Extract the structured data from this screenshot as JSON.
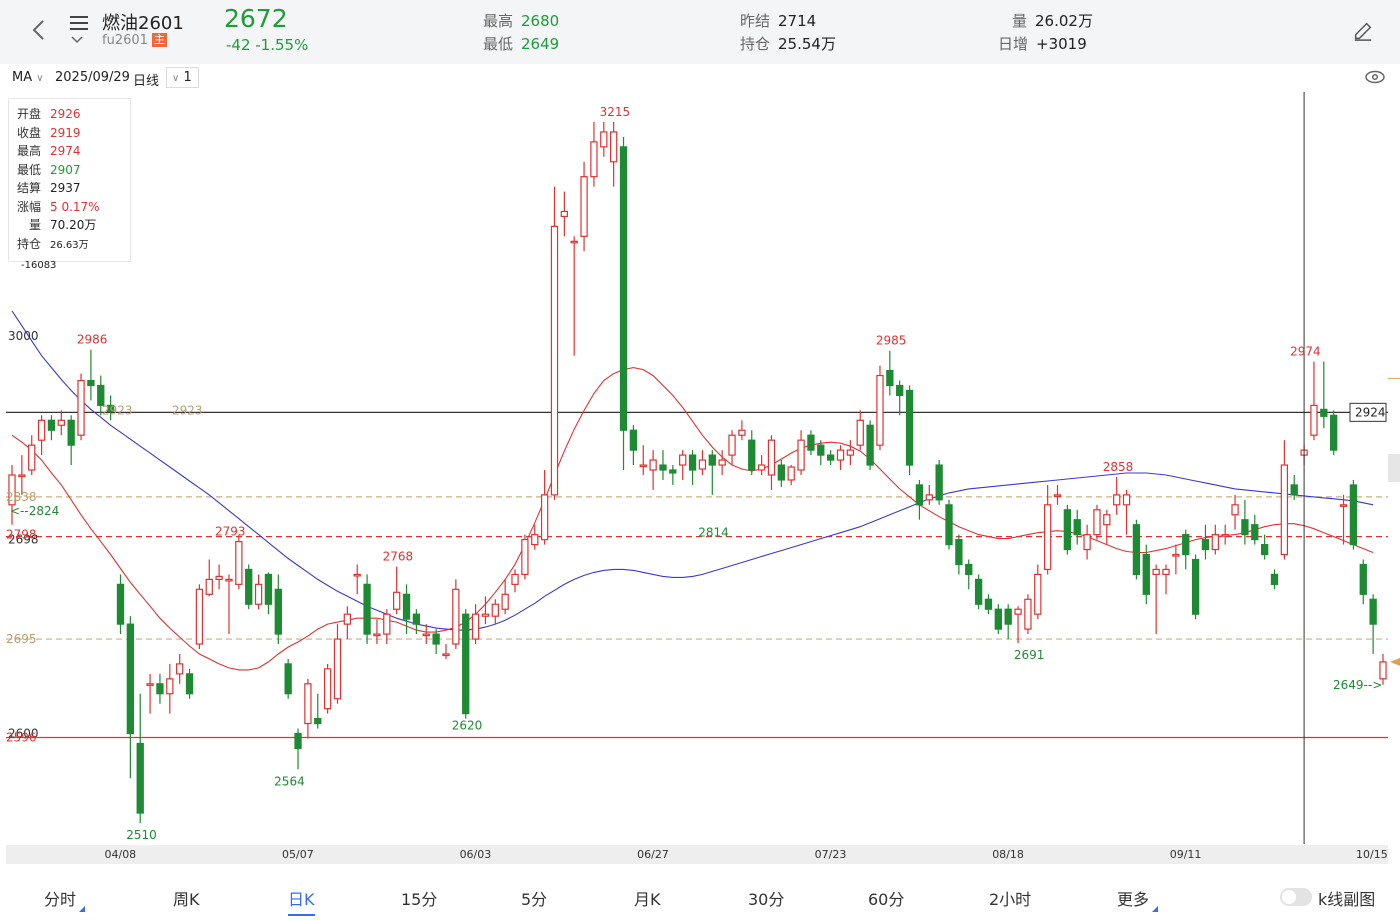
{
  "header": {
    "title": "燃油2601",
    "code": "fu2601",
    "main_badge": "主",
    "price": "2672",
    "change": "-42  -1.55%",
    "high_label": "最高",
    "high": "2680",
    "low_label": "最低",
    "low": "2649",
    "settle_label": "昨结",
    "settle": "2714",
    "oi_label": "持仓",
    "oi": "25.54万",
    "vol_label": "量",
    "vol": "26.02万",
    "daily_label": "日增",
    "daily": "+3019"
  },
  "toolbar": {
    "indicator": "MA",
    "date": "2025/09/29",
    "period": "日线",
    "count": "1"
  },
  "infobox": {
    "open_label": "开盘",
    "open": "2926",
    "close_label": "收盘",
    "close": "2919",
    "high_label": "最高",
    "high": "2974",
    "low_label": "最低",
    "low": "2907",
    "settle_label": "结算",
    "settle": "2937",
    "pct_label": "涨幅",
    "pct": "5  0.17%",
    "vol_label": "量",
    "vol": "70.20万",
    "oi_label": "持仓",
    "oi": "26.63万",
    "oi_chg": "-16083"
  },
  "chart_data": {
    "type": "candlestick",
    "y_axis_labels": [
      "3000",
      "2698",
      "2600"
    ],
    "ylim": [
      2500,
      3250
    ],
    "x_labels": [
      "04/08",
      "05/07",
      "06/03",
      "06/27",
      "07/23",
      "08/18",
      "09/11",
      "10/15"
    ],
    "x_label_index": [
      11,
      29,
      47,
      65,
      83,
      101,
      119,
      136
    ],
    "point_labels": [
      {
        "text": "2986",
        "i": 8,
        "y": 2986,
        "color": "red"
      },
      {
        "text": "2510",
        "i": 13,
        "y": 2510,
        "color": "green"
      },
      {
        "text": "2793",
        "i": 22,
        "y": 2793,
        "color": "red"
      },
      {
        "text": "2564",
        "i": 28,
        "y": 2564,
        "color": "green"
      },
      {
        "text": "2768",
        "i": 39,
        "y": 2768,
        "color": "red"
      },
      {
        "text": "2620",
        "i": 46,
        "y": 2620,
        "color": "green"
      },
      {
        "text": "3215",
        "i": 61,
        "y": 3215,
        "color": "red"
      },
      {
        "text": "2814",
        "i": 71,
        "y": 2814,
        "color": "green"
      },
      {
        "text": "2985",
        "i": 89,
        "y": 2985,
        "color": "red"
      },
      {
        "text": "2691",
        "i": 103,
        "y": 2691,
        "color": "green"
      },
      {
        "text": "2858",
        "i": 112,
        "y": 2858,
        "color": "red"
      },
      {
        "text": "2974",
        "i": 131,
        "y": 2974,
        "color": "red"
      }
    ],
    "side_labels": [
      {
        "text": "2923",
        "y": 2923,
        "color": "#b8a070"
      },
      {
        "text": "2923",
        "y": 2923,
        "color": "#b8a070"
      },
      {
        "text": "2838",
        "y": 2838,
        "color": "#b8a070"
      },
      {
        "text": "2798",
        "y": 2798,
        "color": "#e03232"
      },
      {
        "text": "2695",
        "y": 2695,
        "color": "#b8a070"
      },
      {
        "text": "2596",
        "y": 2596,
        "color": "#e03232"
      }
    ],
    "annotations": [
      "<--2824",
      "2649-->"
    ],
    "crosshair_value": "2924",
    "hlines": [
      {
        "y": 2923,
        "color": "#333333",
        "dash": false
      },
      {
        "y": 2838,
        "color": "#c8b080",
        "dash": true
      },
      {
        "y": 2798,
        "color": "#e03232",
        "dash": true
      },
      {
        "y": 2695,
        "color": "#c8b080",
        "dash": true
      },
      {
        "y": 2596,
        "color": "#e03232",
        "dash": false
      }
    ],
    "candles": [
      [
        2830,
        2860,
        2870,
        2810
      ],
      [
        2860,
        2860,
        2880,
        2840
      ],
      [
        2865,
        2890,
        2900,
        2860
      ],
      [
        2895,
        2915,
        2920,
        2880
      ],
      [
        2915,
        2905,
        2920,
        2895
      ],
      [
        2910,
        2915,
        2925,
        2900
      ],
      [
        2915,
        2890,
        2920,
        2870
      ],
      [
        2900,
        2955,
        2962,
        2895
      ],
      [
        2955,
        2950,
        2986,
        2935
      ],
      [
        2950,
        2930,
        2960,
        2920
      ],
      [
        2930,
        2924,
        2940,
        2915
      ],
      [
        2750,
        2710,
        2760,
        2700
      ],
      [
        2710,
        2600,
        2718,
        2555
      ],
      [
        2590,
        2520,
        2640,
        2510
      ],
      [
        2650,
        2650,
        2660,
        2620
      ],
      [
        2650,
        2640,
        2660,
        2630
      ],
      [
        2640,
        2655,
        2670,
        2620
      ],
      [
        2660,
        2670,
        2680,
        2650
      ],
      [
        2660,
        2640,
        2665,
        2635
      ],
      [
        2690,
        2745,
        2750,
        2685
      ],
      [
        2740,
        2755,
        2775,
        2738
      ],
      [
        2755,
        2758,
        2770,
        2745
      ],
      [
        2755,
        2755,
        2760,
        2700
      ],
      [
        2750,
        2793,
        2800,
        2745
      ],
      [
        2765,
        2730,
        2770,
        2725
      ],
      [
        2730,
        2750,
        2760,
        2725
      ],
      [
        2760,
        2730,
        2762,
        2720
      ],
      [
        2745,
        2700,
        2760,
        2690
      ],
      [
        2670,
        2640,
        2675,
        2635
      ],
      [
        2600,
        2585,
        2605,
        2564
      ],
      [
        2610,
        2650,
        2655,
        2595
      ],
      [
        2615,
        2610,
        2640,
        2605
      ],
      [
        2625,
        2665,
        2670,
        2620
      ],
      [
        2635,
        2695,
        2710,
        2630
      ],
      [
        2710,
        2720,
        2728,
        2695
      ],
      [
        2760,
        2760,
        2770,
        2740
      ],
      [
        2750,
        2700,
        2760,
        2690
      ],
      [
        2700,
        2700,
        2715,
        2690
      ],
      [
        2700,
        2720,
        2725,
        2690
      ],
      [
        2725,
        2742,
        2768,
        2720
      ],
      [
        2740,
        2715,
        2750,
        2700
      ],
      [
        2720,
        2710,
        2725,
        2700
      ],
      [
        2700,
        2700,
        2710,
        2690
      ],
      [
        2700,
        2690,
        2705,
        2680
      ],
      [
        2680,
        2680,
        2690,
        2675
      ],
      [
        2690,
        2745,
        2755,
        2685
      ],
      [
        2720,
        2620,
        2725,
        2615
      ],
      [
        2695,
        2720,
        2730,
        2690
      ],
      [
        2718,
        2720,
        2738,
        2710
      ],
      [
        2718,
        2730,
        2735,
        2710
      ],
      [
        2725,
        2740,
        2755,
        2720
      ],
      [
        2750,
        2760,
        2765,
        2742
      ],
      [
        2760,
        2795,
        2800,
        2755
      ],
      [
        2790,
        2800,
        2810,
        2785
      ],
      [
        2795,
        2840,
        2865,
        2790
      ],
      [
        2840,
        3110,
        3150,
        2835
      ],
      [
        3120,
        3125,
        3145,
        3100
      ],
      [
        3095,
        3095,
        3100,
        2980
      ],
      [
        3100,
        3160,
        3175,
        3085
      ],
      [
        3160,
        3195,
        3215,
        3150
      ],
      [
        3190,
        3205,
        3215,
        3180
      ],
      [
        3175,
        3205,
        3215,
        3150
      ],
      [
        3190,
        2905,
        3200,
        2865
      ],
      [
        2905,
        2885,
        2910,
        2870
      ],
      [
        2870,
        2870,
        2890,
        2860
      ],
      [
        2865,
        2875,
        2885,
        2845
      ],
      [
        2870,
        2865,
        2885,
        2855
      ],
      [
        2865,
        2862,
        2870,
        2850
      ],
      [
        2870,
        2880,
        2885,
        2855
      ],
      [
        2880,
        2865,
        2885,
        2850
      ],
      [
        2866,
        2875,
        2885,
        2860
      ],
      [
        2880,
        2870,
        2885,
        2840
      ],
      [
        2870,
        2875,
        2885,
        2860
      ],
      [
        2880,
        2900,
        2905,
        2870
      ],
      [
        2900,
        2905,
        2915,
        2895
      ],
      [
        2895,
        2865,
        2905,
        2860
      ],
      [
        2865,
        2870,
        2880,
        2860
      ],
      [
        2860,
        2895,
        2900,
        2845
      ],
      [
        2870,
        2855,
        2875,
        2848
      ],
      [
        2855,
        2868,
        2870,
        2850
      ],
      [
        2865,
        2895,
        2905,
        2860
      ],
      [
        2900,
        2885,
        2905,
        2880
      ],
      [
        2890,
        2880,
        2895,
        2870
      ],
      [
        2880,
        2875,
        2885,
        2870
      ],
      [
        2875,
        2885,
        2890,
        2865
      ],
      [
        2880,
        2885,
        2895,
        2870
      ],
      [
        2890,
        2915,
        2925,
        2885
      ],
      [
        2910,
        2870,
        2915,
        2865
      ],
      [
        2890,
        2960,
        2970,
        2885
      ],
      [
        2965,
        2950,
        2985,
        2940
      ],
      [
        2950,
        2940,
        2955,
        2920
      ],
      [
        2945,
        2870,
        2950,
        2860
      ],
      [
        2850,
        2830,
        2855,
        2815
      ],
      [
        2835,
        2840,
        2850,
        2830
      ],
      [
        2870,
        2835,
        2875,
        2830
      ],
      [
        2830,
        2790,
        2835,
        2785
      ],
      [
        2795,
        2770,
        2800,
        2760
      ],
      [
        2770,
        2760,
        2775,
        2745
      ],
      [
        2755,
        2730,
        2760,
        2725
      ],
      [
        2735,
        2725,
        2740,
        2720
      ],
      [
        2725,
        2705,
        2730,
        2700
      ],
      [
        2725,
        2710,
        2730,
        2695
      ],
      [
        2720,
        2725,
        2728,
        2691
      ],
      [
        2705,
        2735,
        2740,
        2700
      ],
      [
        2720,
        2760,
        2770,
        2715
      ],
      [
        2765,
        2830,
        2850,
        2760
      ],
      [
        2840,
        2840,
        2850,
        2830
      ],
      [
        2825,
        2785,
        2830,
        2780
      ],
      [
        2815,
        2800,
        2825,
        2790
      ],
      [
        2785,
        2800,
        2810,
        2775
      ],
      [
        2800,
        2825,
        2830,
        2795
      ],
      [
        2810,
        2820,
        2825,
        2790
      ],
      [
        2830,
        2840,
        2858,
        2820
      ],
      [
        2830,
        2840,
        2845,
        2800
      ],
      [
        2810,
        2760,
        2815,
        2755
      ],
      [
        2780,
        2740,
        2790,
        2730
      ],
      [
        2760,
        2765,
        2770,
        2700
      ],
      [
        2760,
        2765,
        2770,
        2740
      ],
      [
        2780,
        2780,
        2790,
        2760
      ],
      [
        2800,
        2780,
        2805,
        2765
      ],
      [
        2775,
        2720,
        2780,
        2715
      ],
      [
        2795,
        2785,
        2810,
        2775
      ],
      [
        2785,
        2800,
        2810,
        2780
      ],
      [
        2800,
        2800,
        2810,
        2790
      ],
      [
        2820,
        2830,
        2840,
        2805
      ],
      [
        2815,
        2800,
        2835,
        2790
      ],
      [
        2810,
        2795,
        2820,
        2790
      ],
      [
        2790,
        2780,
        2800,
        2775
      ],
      [
        2760,
        2750,
        2765,
        2745
      ],
      [
        2780,
        2870,
        2895,
        2775
      ],
      [
        2850,
        2840,
        2860,
        2835
      ],
      [
        2880,
        2885,
        2890,
        2870
      ],
      [
        2900,
        2930,
        2974,
        2895
      ],
      [
        2926,
        2919,
        2974,
        2907
      ],
      [
        2920,
        2885,
        2925,
        2880
      ],
      [
        2830,
        2830,
        2840,
        2790
      ],
      [
        2850,
        2790,
        2855,
        2785
      ],
      [
        2770,
        2740,
        2775,
        2730
      ],
      [
        2735,
        2710,
        2740,
        2680
      ],
      [
        2655,
        2672,
        2680,
        2649
      ]
    ],
    "ma_red": [
      2900,
      2893,
      2885,
      2875,
      2862,
      2850,
      2835,
      2820,
      2806,
      2793,
      2780,
      2766,
      2752,
      2740,
      2728,
      2716,
      2706,
      2697,
      2688,
      2680,
      2675,
      2670,
      2666,
      2664,
      2664,
      2666,
      2672,
      2680,
      2687,
      2692,
      2698,
      2705,
      2710,
      2712,
      2714,
      2716,
      2716,
      2716,
      2714,
      2712,
      2708,
      2704,
      2702,
      2702,
      2704,
      2707,
      2712,
      2720,
      2730,
      2742,
      2755,
      2770,
      2790,
      2812,
      2835,
      2860,
      2884,
      2906,
      2925,
      2942,
      2955,
      2962,
      2966,
      2968,
      2966,
      2960,
      2950,
      2940,
      2928,
      2914,
      2900,
      2888,
      2878,
      2870,
      2866,
      2864,
      2866,
      2870,
      2876,
      2882,
      2887,
      2890,
      2892,
      2893,
      2892,
      2889,
      2884,
      2876,
      2866,
      2856,
      2846,
      2838,
      2830,
      2824,
      2818,
      2813,
      2808,
      2804,
      2800,
      2798,
      2796,
      2796,
      2798,
      2800,
      2802,
      2803,
      2804,
      2803,
      2801,
      2798,
      2794,
      2790,
      2786,
      2783,
      2782,
      2782,
      2784,
      2786,
      2789,
      2792,
      2795,
      2797,
      2798,
      2799,
      2800,
      2802,
      2805,
      2808,
      2810,
      2811,
      2811,
      2809,
      2806,
      2802,
      2798,
      2794,
      2790,
      2786,
      2782
    ],
    "ma_blue": [
      3025,
      3010,
      2995,
      2980,
      2968,
      2956,
      2945,
      2935,
      2926,
      2918,
      2910,
      2903,
      2896,
      2889,
      2882,
      2875,
      2868,
      2861,
      2854,
      2847,
      2840,
      2832,
      2824,
      2816,
      2808,
      2800,
      2792,
      2784,
      2776,
      2769,
      2762,
      2755,
      2749,
      2743,
      2738,
      2733,
      2728,
      2724,
      2720,
      2716,
      2713,
      2710,
      2708,
      2706,
      2705,
      2704,
      2704,
      2705,
      2707,
      2710,
      2714,
      2719,
      2725,
      2731,
      2738,
      2744,
      2750,
      2755,
      2759,
      2762,
      2764,
      2765,
      2765,
      2764,
      2762,
      2760,
      2758,
      2757,
      2757,
      2758,
      2760,
      2763,
      2766,
      2769,
      2772,
      2775,
      2778,
      2781,
      2784,
      2787,
      2790,
      2793,
      2796,
      2799,
      2802,
      2805,
      2808,
      2812,
      2816,
      2820,
      2824,
      2828,
      2832,
      2836,
      2839,
      2842,
      2844,
      2846,
      2847,
      2848,
      2849,
      2850,
      2851,
      2852,
      2853,
      2854,
      2855,
      2856,
      2857,
      2858,
      2859,
      2860,
      2861,
      2862,
      2862,
      2862,
      2861,
      2860,
      2858,
      2856,
      2854,
      2852,
      2850,
      2848,
      2846,
      2845,
      2844,
      2843,
      2842,
      2841,
      2840,
      2839,
      2838,
      2837,
      2836,
      2835,
      2834,
      2832,
      2830
    ]
  },
  "tabs": [
    "分时",
    "周K",
    "日K",
    "15分",
    "5分",
    "月K",
    "30分",
    "60分",
    "2小时",
    "更多"
  ],
  "active_tab": "日K",
  "toggle_label": "k线副图"
}
